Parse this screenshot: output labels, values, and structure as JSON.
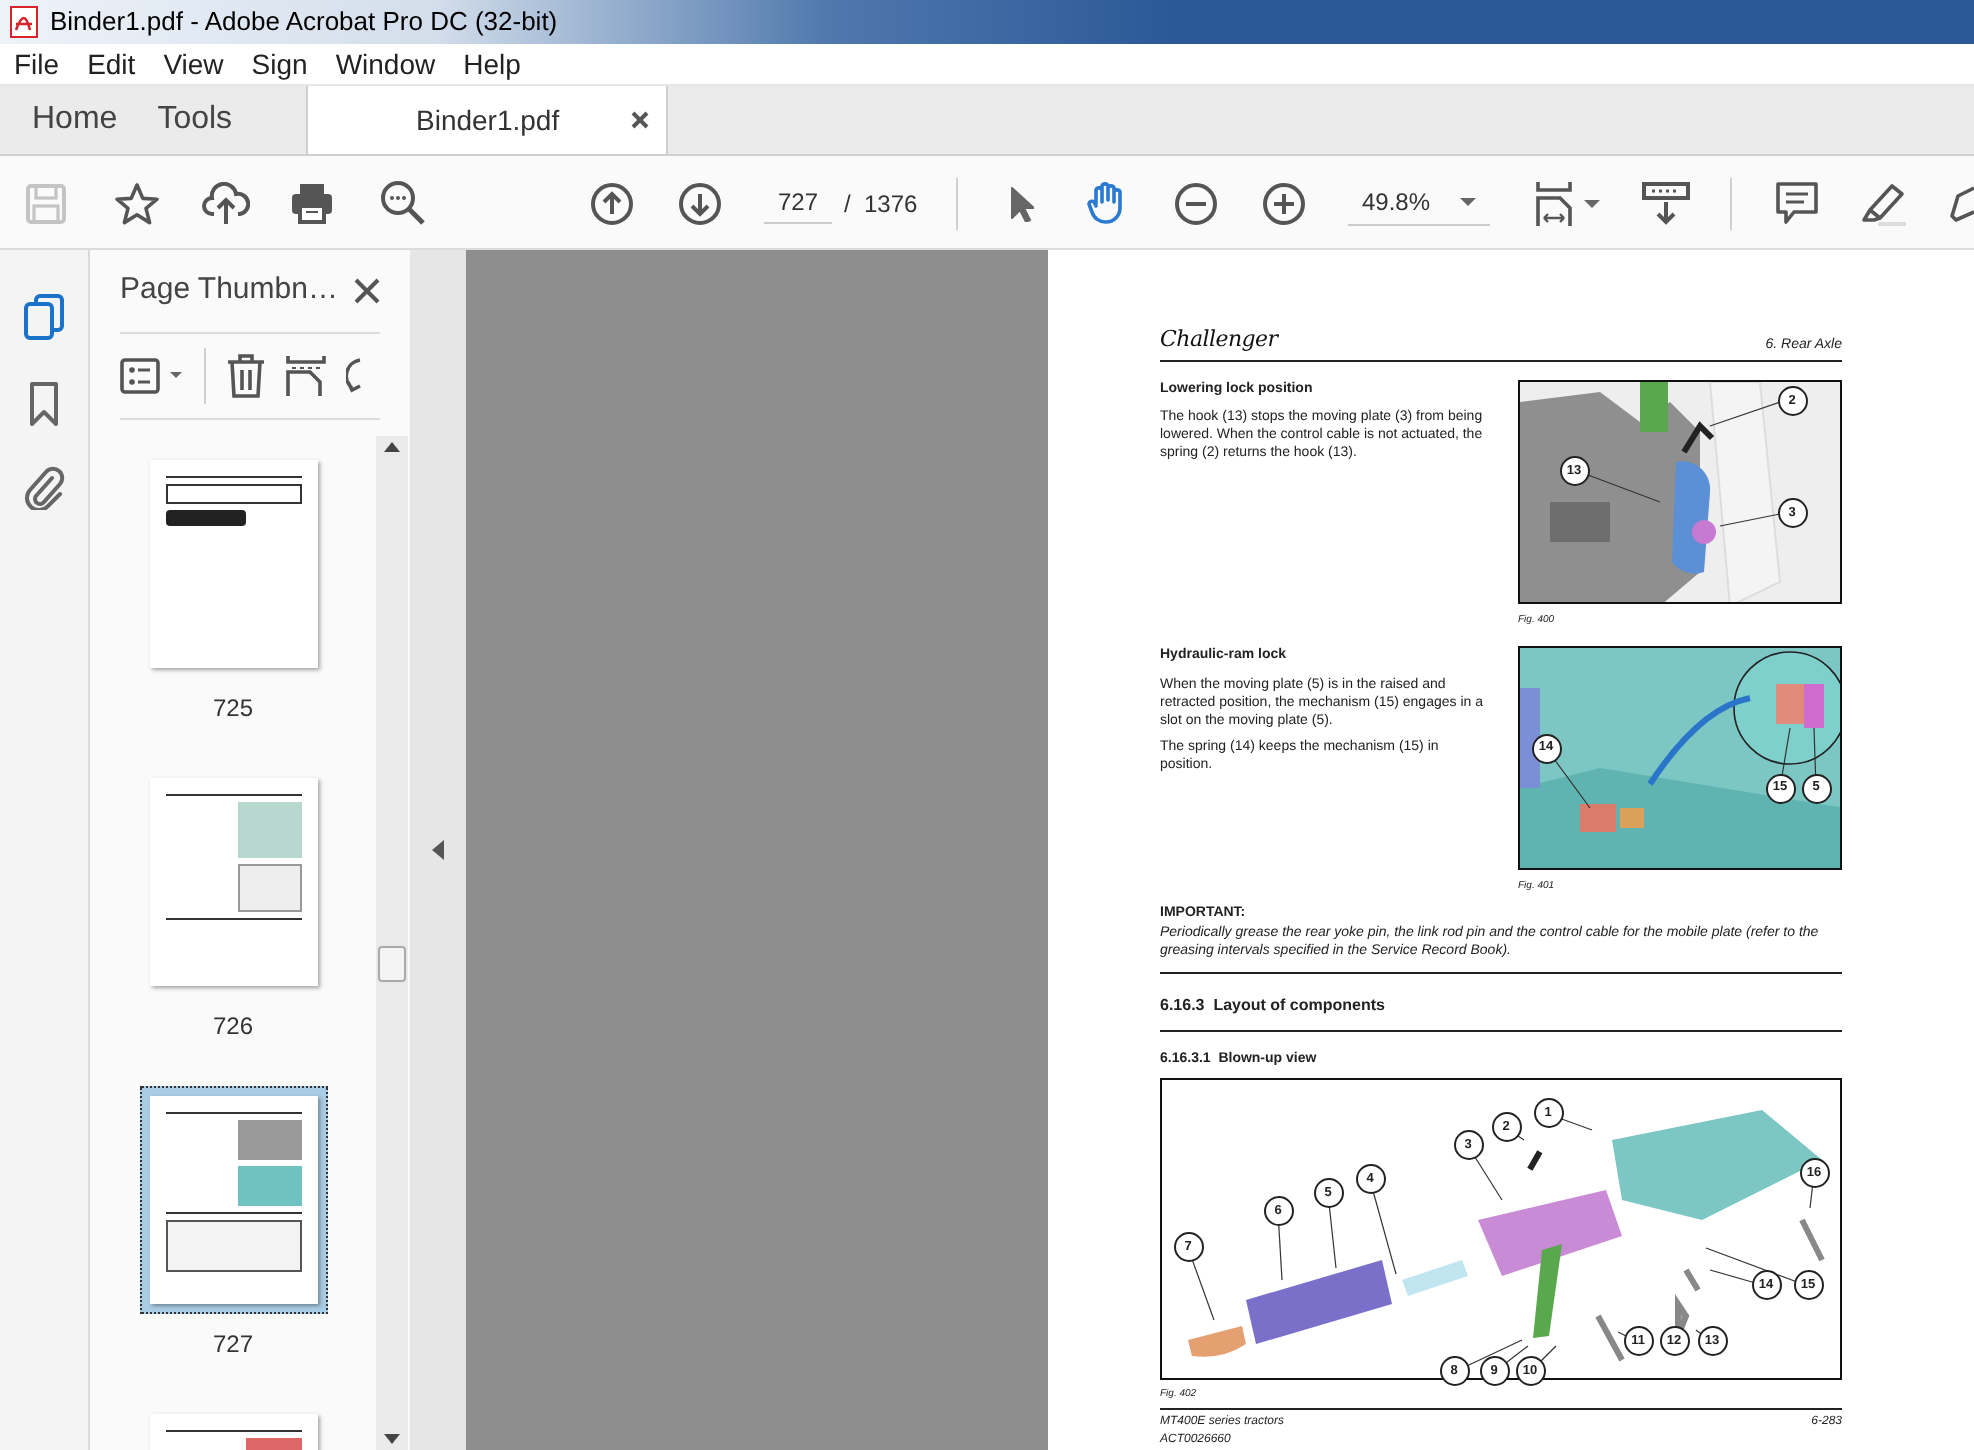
{
  "window": {
    "title": "Binder1.pdf - Adobe Acrobat Pro DC (32-bit)"
  },
  "menu": [
    "File",
    "Edit",
    "View",
    "Sign",
    "Window",
    "Help"
  ],
  "tabs": [
    {
      "label": "Home",
      "selected": false
    },
    {
      "label": "Tools",
      "selected": false
    },
    {
      "label": "Binder1.pdf",
      "selected": true
    }
  ],
  "toolbar": {
    "save_disabled": true,
    "page_current": "727",
    "page_separator": "/",
    "page_total": "1376",
    "zoom": "49.8%",
    "pointer_tools": [
      {
        "kind": "select",
        "selected": false
      },
      {
        "kind": "hand",
        "selected": true
      }
    ]
  },
  "sidebar": {
    "rail": [
      {
        "kind": "pages",
        "selected": true
      },
      {
        "kind": "bookmarks",
        "selected": false
      },
      {
        "kind": "attachments",
        "selected": false
      }
    ],
    "title": "Page Thumbn…",
    "thumbnails": [
      {
        "label": "725",
        "selected": false
      },
      {
        "label": "726",
        "selected": false
      },
      {
        "label": "727",
        "selected": true
      },
      {
        "selected": false
      }
    ]
  },
  "page": {
    "logo": "Challenger",
    "chapter": "6. Rear Axle",
    "sections": [
      {
        "heading": "Lowering lock position",
        "paragraphs": [
          "The hook (13) stops the moving plate (3) from being lowered. When the control cable is not actuated, the spring (2) returns the hook (13)."
        ],
        "figure": {
          "kind": "hook",
          "caption": "Fig. 400",
          "callouts": [
            "2",
            "13",
            "3"
          ]
        }
      },
      {
        "heading": "Hydraulic-ram lock",
        "paragraphs": [
          "When the moving plate (5) is in the raised and retracted position, the mechanism (15) engages in a slot on the moving plate (5).",
          "The spring (14) keeps the mechanism (15) in position."
        ],
        "figure": {
          "kind": "ram",
          "caption": "Fig. 401",
          "callouts": [
            "14",
            "15",
            "5"
          ]
        }
      }
    ],
    "note": {
      "title": "IMPORTANT:",
      "text": "Periodically grease the rear yoke pin, the link rod pin and the control cable for the mobile plate (refer to the greasing intervals specified in the Service Record Book)."
    },
    "subsection": "6.16.3  Layout of components",
    "subsubsection": "6.16.3.1  Blown-up view",
    "figure": {
      "caption": "Fig. 402",
      "callouts": [
        "1",
        "2",
        "3",
        "4",
        "5",
        "6",
        "7",
        "8",
        "9",
        "10",
        "11",
        "12",
        "13",
        "14",
        "15",
        "16"
      ]
    },
    "footer": {
      "model": "MT400E series tractors",
      "code": "ACT0026660",
      "page_number": "6-283"
    }
  }
}
